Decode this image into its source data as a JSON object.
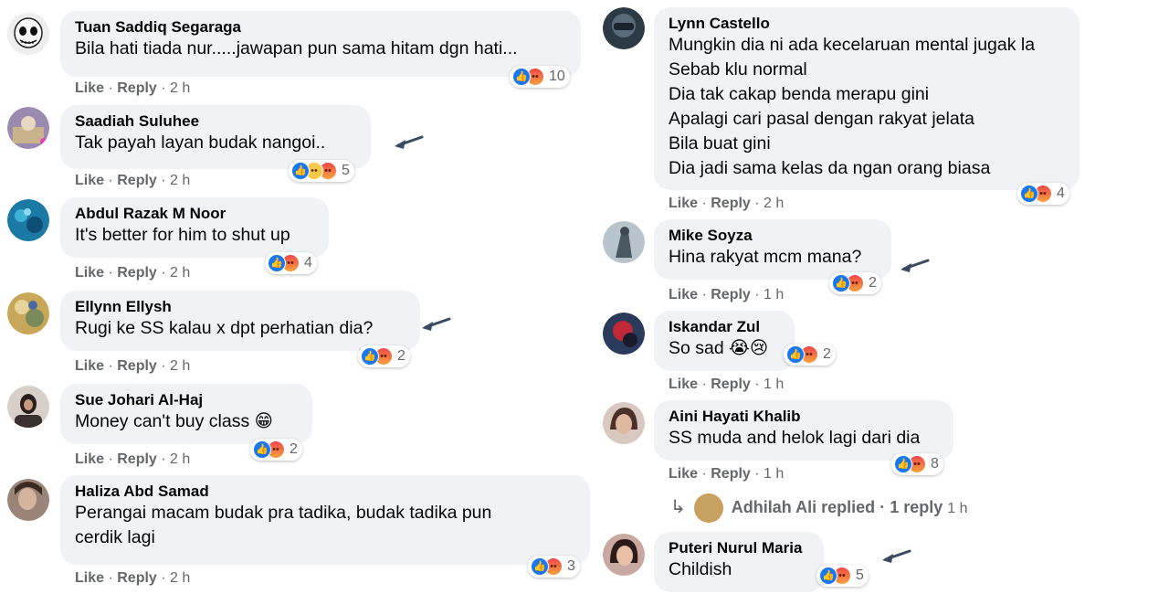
{
  "left_column": [
    {
      "name": "Tuan Saddiq Segaraga",
      "text": "Bila hati tiada nur.....jawapan pun sama hitam dgn hati...",
      "like": "Like",
      "reply": "Reply",
      "time": "2 h",
      "count": "10",
      "reactions": [
        "like",
        "angry"
      ],
      "avatar_color": "#dcdcdc",
      "arrow": false
    },
    {
      "name": "Saadiah Suluhee",
      "text": "Tak payah layan budak nangoi..",
      "like": "Like",
      "reply": "Reply",
      "time": "2 h",
      "count": "5",
      "reactions": [
        "like",
        "haha",
        "angry"
      ],
      "avatar_color": "#8a7a9a",
      "arrow": true
    },
    {
      "name": "Abdul Razak M Noor",
      "text": "It's better for him to shut up",
      "like": "Like",
      "reply": "Reply",
      "time": "2 h",
      "count": "4",
      "reactions": [
        "like",
        "angry"
      ],
      "avatar_color": "#1f7ea6",
      "arrow": false
    },
    {
      "name": "Ellynn Ellysh",
      "text": "Rugi ke SS kalau x dpt perhatian dia?",
      "like": "Like",
      "reply": "Reply",
      "time": "2 h",
      "count": "2",
      "reactions": [
        "like",
        "angry"
      ],
      "avatar_color": "#b39a4a",
      "arrow": true
    },
    {
      "name": "Sue Johari Al-Haj",
      "text": "Money can't buy class 😁",
      "like": "Like",
      "reply": "Reply",
      "time": "2 h",
      "count": "2",
      "reactions": [
        "like",
        "angry"
      ],
      "avatar_color": "#5a4a44",
      "arrow": false
    },
    {
      "name": "Haliza Abd Samad",
      "text": "Perangai macam budak pra tadika, budak tadika pun\ncerdik lagi",
      "like": "Like",
      "reply": "Reply",
      "time": "2 h",
      "count": "3",
      "reactions": [
        "like",
        "angry"
      ],
      "avatar_color": "#8f7868",
      "arrow": false
    }
  ],
  "right_column": [
    {
      "name": "Lynn Castello",
      "text": "Mungkin dia ni ada kecelaruan mental jugak la\nSebab klu normal\nDia tak cakap benda merapu gini\nApalagi cari pasal dengan rakyat jelata\nBila buat gini\nDia jadi sama kelas da ngan orang biasa",
      "like": "Like",
      "reply": "Reply",
      "time": "2 h",
      "count": "4",
      "reactions": [
        "like",
        "angry"
      ],
      "avatar_color": "#3d4c5a",
      "arrow": false
    },
    {
      "name": "Mike Soyza",
      "text": "Hina rakyat mcm mana?",
      "like": "Like",
      "reply": "Reply",
      "time": "1 h",
      "count": "2",
      "reactions": [
        "like",
        "angry"
      ],
      "avatar_color": "#7a8a92",
      "arrow": true
    },
    {
      "name": "Iskandar Zul",
      "text": "So sad 😭😢",
      "like": "Like",
      "reply": "Reply",
      "time": "1 h",
      "count": "2",
      "reactions": [
        "like",
        "angry"
      ],
      "avatar_color": "#5a2a3a",
      "arrow": false
    },
    {
      "name": "Aini Hayati Khalib",
      "text": "SS muda and helok lagi dari dia",
      "like": "Like",
      "reply": "Reply",
      "time": "1 h",
      "count": "8",
      "reactions": [
        "like",
        "angry"
      ],
      "avatar_color": "#a07864",
      "arrow": false
    },
    {
      "name": "Puteri Nurul Maria",
      "text": "Childish",
      "like": "",
      "reply": "",
      "time": "",
      "count": "5",
      "reactions": [
        "like",
        "angry"
      ],
      "avatar_color": "#8a5a4a",
      "arrow": true
    }
  ],
  "reply_thread": {
    "name": "Adhilah Ali",
    "replied": "replied",
    "sep": "·",
    "count_label": "1 reply",
    "time": "1 h",
    "avatar_color": "#c8a060"
  },
  "colors": {
    "bubble": "#f0f2f5",
    "meta": "#65676b",
    "like_blue": "#1877f2",
    "arrow": "#3b4a60"
  }
}
